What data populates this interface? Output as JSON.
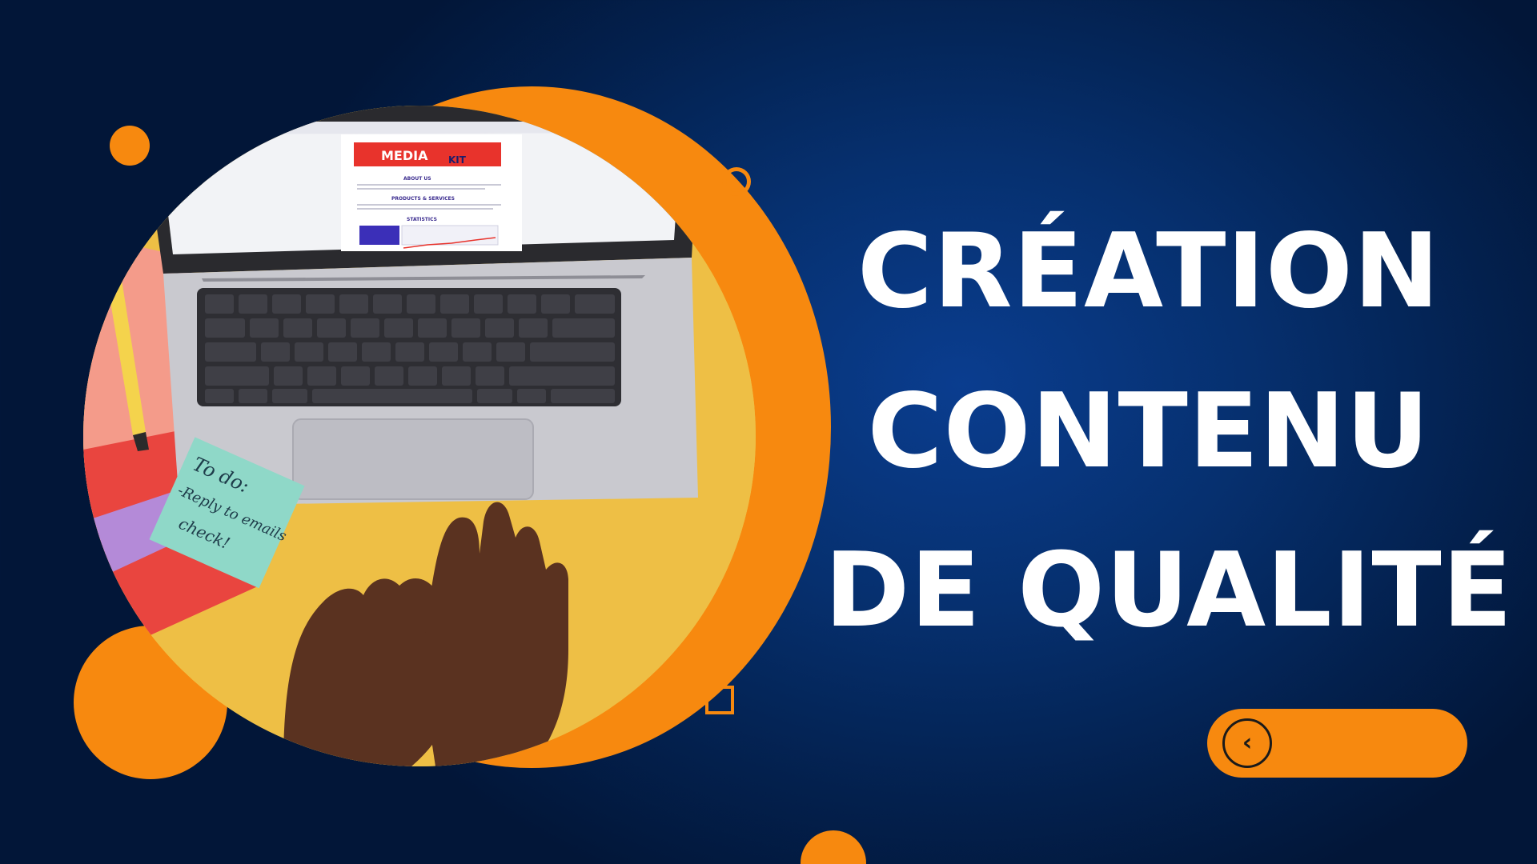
{
  "colors": {
    "accent_orange": "#f7890f",
    "background_navy": "#052a63",
    "headline_text": "#ffffff"
  },
  "headline": {
    "line1": "CRÉATION",
    "line2": "CONTENU",
    "line3": "DE QUALITÉ"
  },
  "photo": {
    "screen": {
      "banner_media": "MEDIA",
      "banner_kit": "KIT",
      "about_heading": "ABOUT US",
      "products_heading": "PRODUCTS & SERVICES",
      "statistics_heading": "STATISTICS"
    },
    "sticky_note": {
      "line1": "To do:",
      "line2": "-Reply to emails",
      "line3": "check!"
    }
  },
  "nav_button": {
    "icon": "chevron-left-icon",
    "glyph": "‹"
  }
}
